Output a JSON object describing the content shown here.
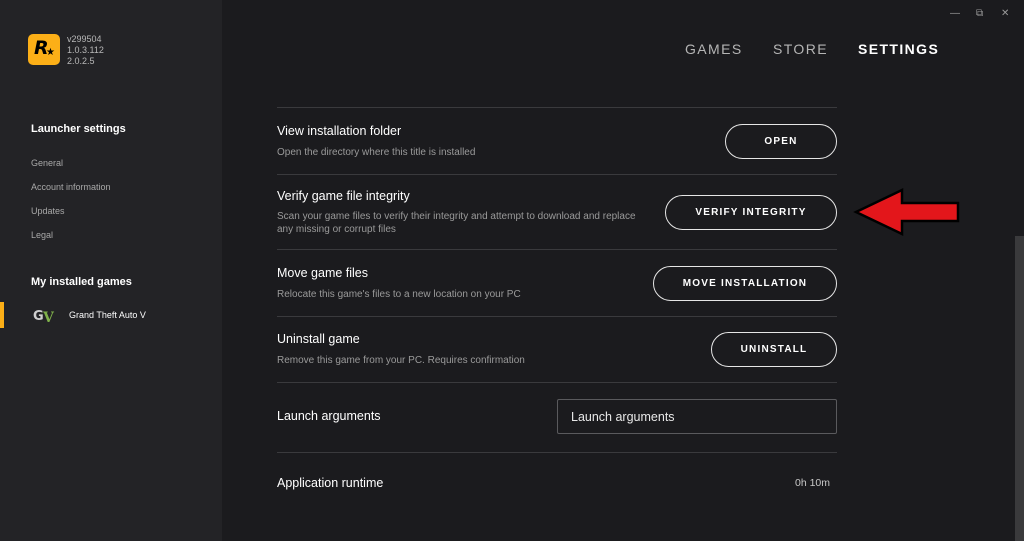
{
  "app": {
    "versions": [
      "v299504",
      "1.0.3.112",
      "2.0.2.5"
    ]
  },
  "sidebar": {
    "launcher_heading": "Launcher settings",
    "items": [
      {
        "label": "General"
      },
      {
        "label": "Account information"
      },
      {
        "label": "Updates"
      },
      {
        "label": "Legal"
      }
    ],
    "games_heading": "My installed games",
    "games": [
      {
        "label": "Grand Theft Auto V",
        "selected": true
      }
    ]
  },
  "nav": {
    "tabs": [
      {
        "label": "GAMES",
        "active": false
      },
      {
        "label": "STORE",
        "active": false
      },
      {
        "label": "SETTINGS",
        "active": true
      }
    ]
  },
  "window_controls": {
    "minimize": "—",
    "restore": "⧉",
    "close": "✕"
  },
  "settings": {
    "view_folder": {
      "title": "View installation folder",
      "desc": "Open the directory where this title is installed",
      "button": "OPEN"
    },
    "verify": {
      "title": "Verify game file integrity",
      "desc": "Scan your game files to verify their integrity and attempt to download and replace any missing or corrupt files",
      "button": "VERIFY INTEGRITY"
    },
    "move": {
      "title": "Move game files",
      "desc": "Relocate this game's files to a new location on your PC",
      "button": "MOVE INSTALLATION"
    },
    "uninstall": {
      "title": "Uninstall game",
      "desc": "Remove this game from your PC. Requires confirmation",
      "button": "UNINSTALL"
    },
    "launch_args": {
      "title": "Launch arguments",
      "placeholder": "Launch arguments"
    },
    "runtime": {
      "title": "Application runtime",
      "value": "0h 10m"
    }
  },
  "annotation": {
    "arrow_color": "#e3161b"
  },
  "colors": {
    "accent": "#fcaf17",
    "background": "#1b1b1e",
    "sidebar": "#232326"
  }
}
